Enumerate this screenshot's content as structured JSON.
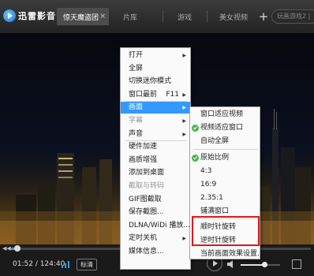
{
  "app": {
    "logo_text": "迅雷影音",
    "logo_caret": "▾"
  },
  "tabs": [
    {
      "label": "惊天魔盗团",
      "close": "×"
    },
    {
      "label": "片库"
    },
    {
      "label": "游戏"
    },
    {
      "label": "美女视频"
    }
  ],
  "add_tab": "+",
  "search": {
    "placeholder": "玩画游戏2 |"
  },
  "player": {
    "time": "01:52 / 124:40",
    "quality": "标清",
    "progress_fraction": 0.02,
    "volume_fraction": 0.6
  },
  "main_menu": {
    "items": [
      {
        "label": "打开",
        "submenu": true
      },
      {
        "label": "全屏"
      },
      {
        "label": "切换迷你模式"
      },
      {
        "label": "窗口最前",
        "shortcut": "F11",
        "submenu": true
      },
      {
        "label": "画面",
        "submenu": true,
        "highlighted": true
      },
      {
        "label": "字幕",
        "submenu": true,
        "disabled": true
      },
      {
        "label": "声音",
        "submenu": true
      },
      {
        "label": "硬件加速"
      },
      {
        "label": "画质增强"
      },
      {
        "label": "添加到桌面"
      },
      {
        "label": "截取与转码",
        "disabled": true
      },
      {
        "label": "GIF图截取"
      },
      {
        "label": "保存截图..."
      },
      {
        "label": "DLNA/WiDi 播放..."
      },
      {
        "label": "定时关机",
        "submenu": true
      },
      {
        "label": "媒体信息..."
      }
    ],
    "arrow_glyph": "▶"
  },
  "sub_menu": {
    "items": [
      {
        "label": "窗口适应视频"
      },
      {
        "label": "视频适应窗口",
        "checked": true
      },
      {
        "label": "自动全屏"
      },
      {
        "label": "原始比例",
        "checked": true
      },
      {
        "label": "4:3"
      },
      {
        "label": "16:9"
      },
      {
        "label": "2.35:1"
      },
      {
        "label": "铺满窗口"
      },
      {
        "label": "顺时针旋转"
      },
      {
        "label": "逆时针旋转"
      },
      {
        "label": "当前画面效果设置..."
      }
    ]
  },
  "colors": {
    "menu_highlight": "#3399ff",
    "annotation_box": "#e0151b",
    "progress": "#2aa0ff",
    "check": "#45b64a"
  },
  "icons": {
    "logo": "logo-icon",
    "close": "close-icon",
    "add": "add-tab-icon",
    "signal": "signal-icon",
    "play": "play-icon",
    "volume": "volume-icon",
    "fullscreen": "fullscreen-icon",
    "submenu": "chevron-right-icon",
    "check": "check-icon"
  }
}
